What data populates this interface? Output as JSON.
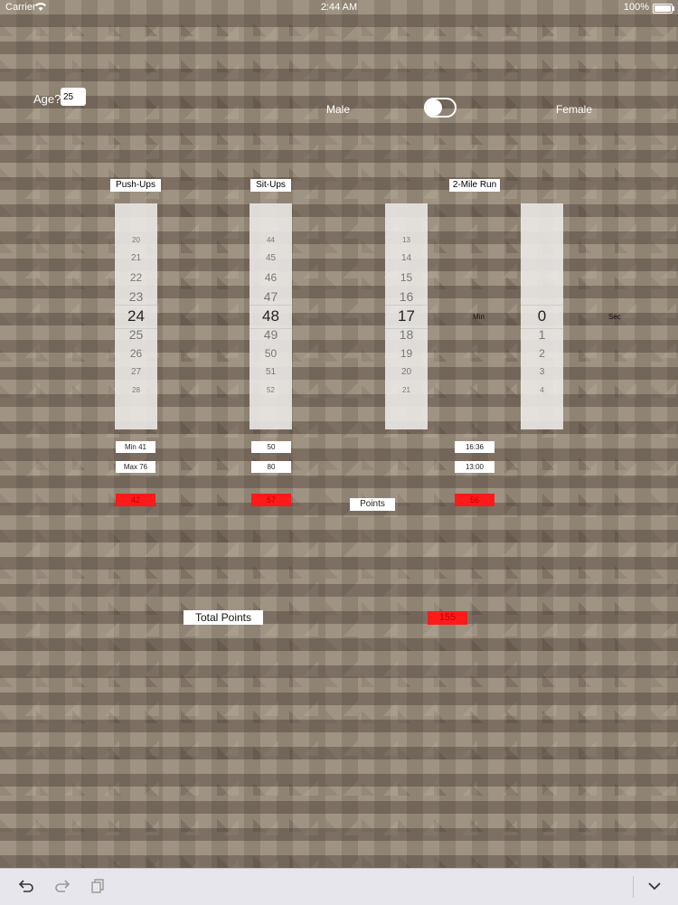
{
  "status_bar": {
    "carrier": "Carrier",
    "time": "2:44 AM",
    "battery": "100%"
  },
  "age": {
    "label": "Age?",
    "value": "25"
  },
  "gender": {
    "male": "Male",
    "female": "Female",
    "toggle_on": false
  },
  "events": {
    "pushups": {
      "label": "Push-Ups",
      "min": "Min 41",
      "max": "Max 76",
      "points": "42",
      "picker": [
        "20",
        "21",
        "22",
        "23",
        "24",
        "25",
        "26",
        "27",
        "28"
      ],
      "selected": "24"
    },
    "situps": {
      "label": "Sit-Ups",
      "min": "50",
      "max": "80",
      "points": "57",
      "picker": [
        "44",
        "45",
        "46",
        "47",
        "48",
        "49",
        "50",
        "51",
        "52"
      ],
      "selected": "48"
    },
    "run": {
      "label": "2-Mile Run",
      "min": "16:36",
      "max": "13:00",
      "points": "56",
      "min_picker": [
        "13",
        "14",
        "15",
        "16",
        "17",
        "18",
        "19",
        "20",
        "21"
      ],
      "min_selected": "17",
      "min_unit": "Min",
      "sec_picker": [
        "0",
        "1",
        "2",
        "3",
        "4"
      ],
      "sec_selected": "0",
      "sec_unit": "Sec"
    }
  },
  "points_label": "Points",
  "total": {
    "label": "Total Points",
    "value": "155"
  },
  "colors": {
    "score_red": "#ff1a1a",
    "picker_bg": "#eeece9"
  },
  "toolbar": {
    "undo": "undo-icon",
    "redo": "redo-icon",
    "paste": "paste-icon",
    "dismiss": "chevron-down-icon"
  }
}
